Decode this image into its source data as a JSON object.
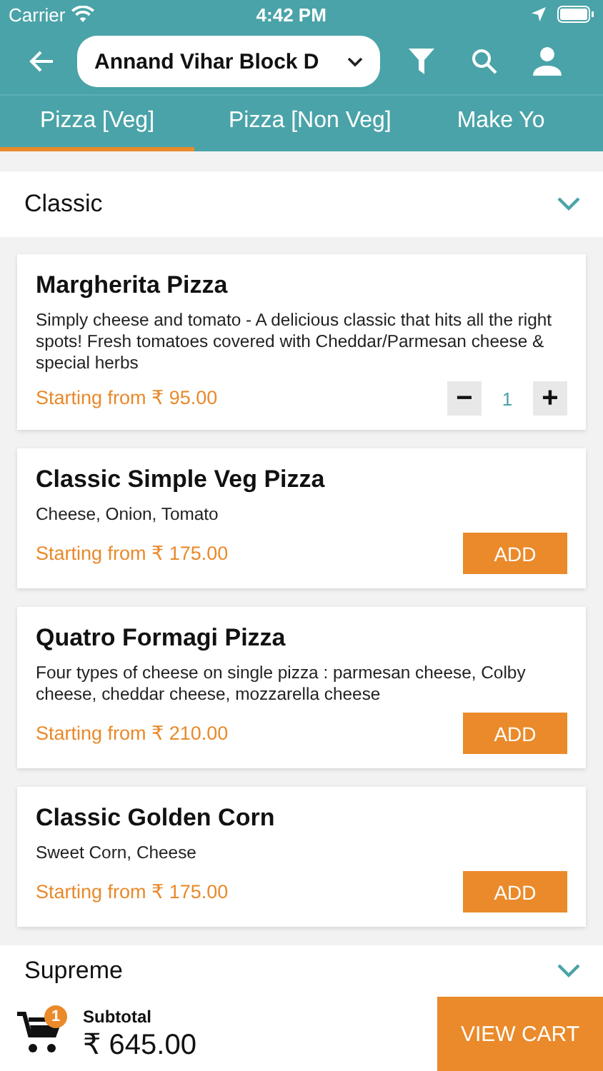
{
  "status_bar": {
    "carrier": "Carrier",
    "time": "4:42 PM"
  },
  "header": {
    "location": "Annand Vihar Block D"
  },
  "tabs": [
    {
      "label": "Pizza [Veg]",
      "selected": true
    },
    {
      "label": "Pizza [Non Veg]",
      "selected": false
    },
    {
      "label": "Make Yo",
      "selected": false
    }
  ],
  "sections": [
    {
      "title": "Classic",
      "items": [
        {
          "kind": "stepper",
          "name": "Margherita Pizza",
          "description": "Simply cheese and tomato - A delicious classic that hits all the right spots! Fresh tomatoes covered with Cheddar/Parmesan cheese & special herbs",
          "price": "Starting from ₹ 95.00",
          "minus": "−",
          "quantity": "1",
          "plus": "+"
        },
        {
          "kind": "add",
          "name": "Classic Simple Veg Pizza",
          "description": "Cheese, Onion, Tomato",
          "price": "Starting from ₹ 175.00",
          "button": "ADD"
        },
        {
          "kind": "add",
          "name": "Quatro Formagi Pizza",
          "description": "Four types of cheese on single pizza : parmesan cheese,  Colby cheese, cheddar cheese, mozzarella cheese",
          "price": "Starting from ₹ 210.00",
          "button": "ADD"
        },
        {
          "kind": "add",
          "name": "Classic Golden Corn",
          "description": "Sweet Corn,  Cheese",
          "price": "Starting from ₹ 175.00",
          "button": "ADD"
        }
      ]
    },
    {
      "title": "Supreme"
    }
  ],
  "cart_bar": {
    "badge": "1",
    "label": "Subtotal",
    "subtotal": "₹ 645.00",
    "button": "VIEW CART"
  }
}
